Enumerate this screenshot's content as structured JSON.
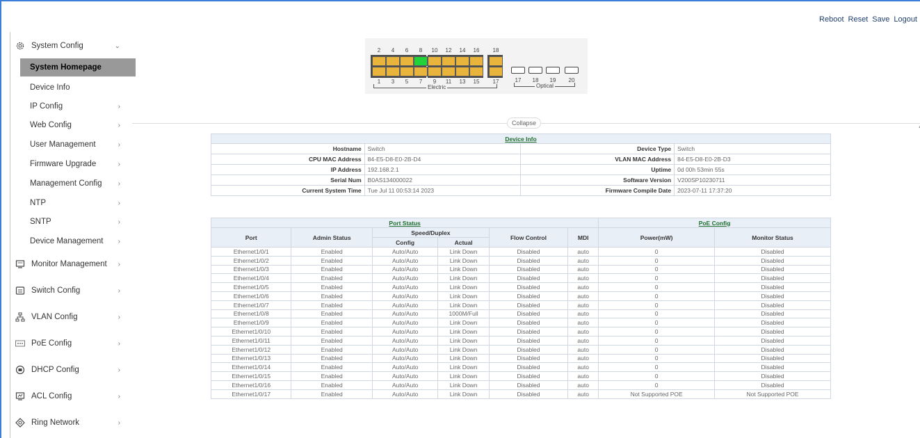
{
  "top_links": [
    "Reboot",
    "Reset",
    "Save",
    "Logout"
  ],
  "sidebar": {
    "groups": [
      {
        "label": "System Config",
        "icon": "gear-icon",
        "expanded": true
      },
      {
        "label": "Monitor Management",
        "icon": "monitor-icon"
      },
      {
        "label": "Switch Config",
        "icon": "switch-icon"
      },
      {
        "label": "VLAN Config",
        "icon": "vlan-icon"
      },
      {
        "label": "PoE Config",
        "icon": "poe-icon"
      },
      {
        "label": "DHCP Config",
        "icon": "dhcp-icon"
      },
      {
        "label": "ACL Config",
        "icon": "acl-icon"
      },
      {
        "label": "Ring Network",
        "icon": "ring-icon"
      }
    ],
    "sub_items": [
      "System Homepage",
      "Device Info",
      "IP Config",
      "Web Config",
      "User Management",
      "Firmware Upgrade",
      "Management Config",
      "NTP",
      "SNTP",
      "Device Management"
    ],
    "active": "System Homepage"
  },
  "panel": {
    "top_numbers": [
      "2",
      "4",
      "6",
      "8",
      "10",
      "12",
      "14",
      "16",
      "18"
    ],
    "bottom_numbers": [
      "1",
      "3",
      "5",
      "7",
      "9",
      "11",
      "13",
      "15",
      "17"
    ],
    "optical_numbers": [
      "17",
      "18",
      "19",
      "20"
    ],
    "electric_label": "Electric",
    "optical_label": "Optical",
    "linked_port": "8",
    "colors": {
      "port": "#e8b43c",
      "link_up": "#22d23a"
    }
  },
  "collapse_label": "Collapse",
  "device_info": {
    "title": "Device Info",
    "rows": [
      [
        "Hostname",
        "Switch",
        "Device Type",
        "Switch"
      ],
      [
        "CPU MAC Address",
        "84-E5-D8-E0-2B-D4",
        "VLAN MAC Address",
        "84-E5-D8-E0-2B-D3"
      ],
      [
        "IP Address",
        "192.168.2.1",
        "Uptime",
        "0d 00h 53min 55s"
      ],
      [
        "Serial Num",
        "B0AS134000022",
        "Software Version",
        "V200SP10230711"
      ],
      [
        "Current System Time",
        "Tue Jul 11 00:53:14 2023",
        "Firmware Compile Date",
        "2023-07-11 17:37:20"
      ]
    ]
  },
  "port_status": {
    "title": "Port Status",
    "poe_title": "PoE Config",
    "headers": {
      "port": "Port",
      "admin": "Admin Status",
      "speed": "Speed/Duplex",
      "config": "Config",
      "actual": "Actual",
      "flow": "Flow Control",
      "mdi": "MDI",
      "power": "Power(mW)",
      "monitor": "Monitor Status"
    },
    "rows": [
      [
        "Ethernet1/0/1",
        "Enabled",
        "Auto/Auto",
        "Link Down",
        "Disabled",
        "auto",
        "0",
        "Disabled"
      ],
      [
        "Ethernet1/0/2",
        "Enabled",
        "Auto/Auto",
        "Link Down",
        "Disabled",
        "auto",
        "0",
        "Disabled"
      ],
      [
        "Ethernet1/0/3",
        "Enabled",
        "Auto/Auto",
        "Link Down",
        "Disabled",
        "auto",
        "0",
        "Disabled"
      ],
      [
        "Ethernet1/0/4",
        "Enabled",
        "Auto/Auto",
        "Link Down",
        "Disabled",
        "auto",
        "0",
        "Disabled"
      ],
      [
        "Ethernet1/0/5",
        "Enabled",
        "Auto/Auto",
        "Link Down",
        "Disabled",
        "auto",
        "0",
        "Disabled"
      ],
      [
        "Ethernet1/0/6",
        "Enabled",
        "Auto/Auto",
        "Link Down",
        "Disabled",
        "auto",
        "0",
        "Disabled"
      ],
      [
        "Ethernet1/0/7",
        "Enabled",
        "Auto/Auto",
        "Link Down",
        "Disabled",
        "auto",
        "0",
        "Disabled"
      ],
      [
        "Ethernet1/0/8",
        "Enabled",
        "Auto/Auto",
        "1000M/Full",
        "Disabled",
        "auto",
        "0",
        "Disabled"
      ],
      [
        "Ethernet1/0/9",
        "Enabled",
        "Auto/Auto",
        "Link Down",
        "Disabled",
        "auto",
        "0",
        "Disabled"
      ],
      [
        "Ethernet1/0/10",
        "Enabled",
        "Auto/Auto",
        "Link Down",
        "Disabled",
        "auto",
        "0",
        "Disabled"
      ],
      [
        "Ethernet1/0/11",
        "Enabled",
        "Auto/Auto",
        "Link Down",
        "Disabled",
        "auto",
        "0",
        "Disabled"
      ],
      [
        "Ethernet1/0/12",
        "Enabled",
        "Auto/Auto",
        "Link Down",
        "Disabled",
        "auto",
        "0",
        "Disabled"
      ],
      [
        "Ethernet1/0/13",
        "Enabled",
        "Auto/Auto",
        "Link Down",
        "Disabled",
        "auto",
        "0",
        "Disabled"
      ],
      [
        "Ethernet1/0/14",
        "Enabled",
        "Auto/Auto",
        "Link Down",
        "Disabled",
        "auto",
        "0",
        "Disabled"
      ],
      [
        "Ethernet1/0/15",
        "Enabled",
        "Auto/Auto",
        "Link Down",
        "Disabled",
        "auto",
        "0",
        "Disabled"
      ],
      [
        "Ethernet1/0/16",
        "Enabled",
        "Auto/Auto",
        "Link Down",
        "Disabled",
        "auto",
        "0",
        "Disabled"
      ],
      [
        "Ethernet1/0/17",
        "Enabled",
        "Auto/Auto",
        "Link Down",
        "Disabled",
        "auto",
        "Not Supported POE",
        "Not Supported POE"
      ]
    ]
  }
}
